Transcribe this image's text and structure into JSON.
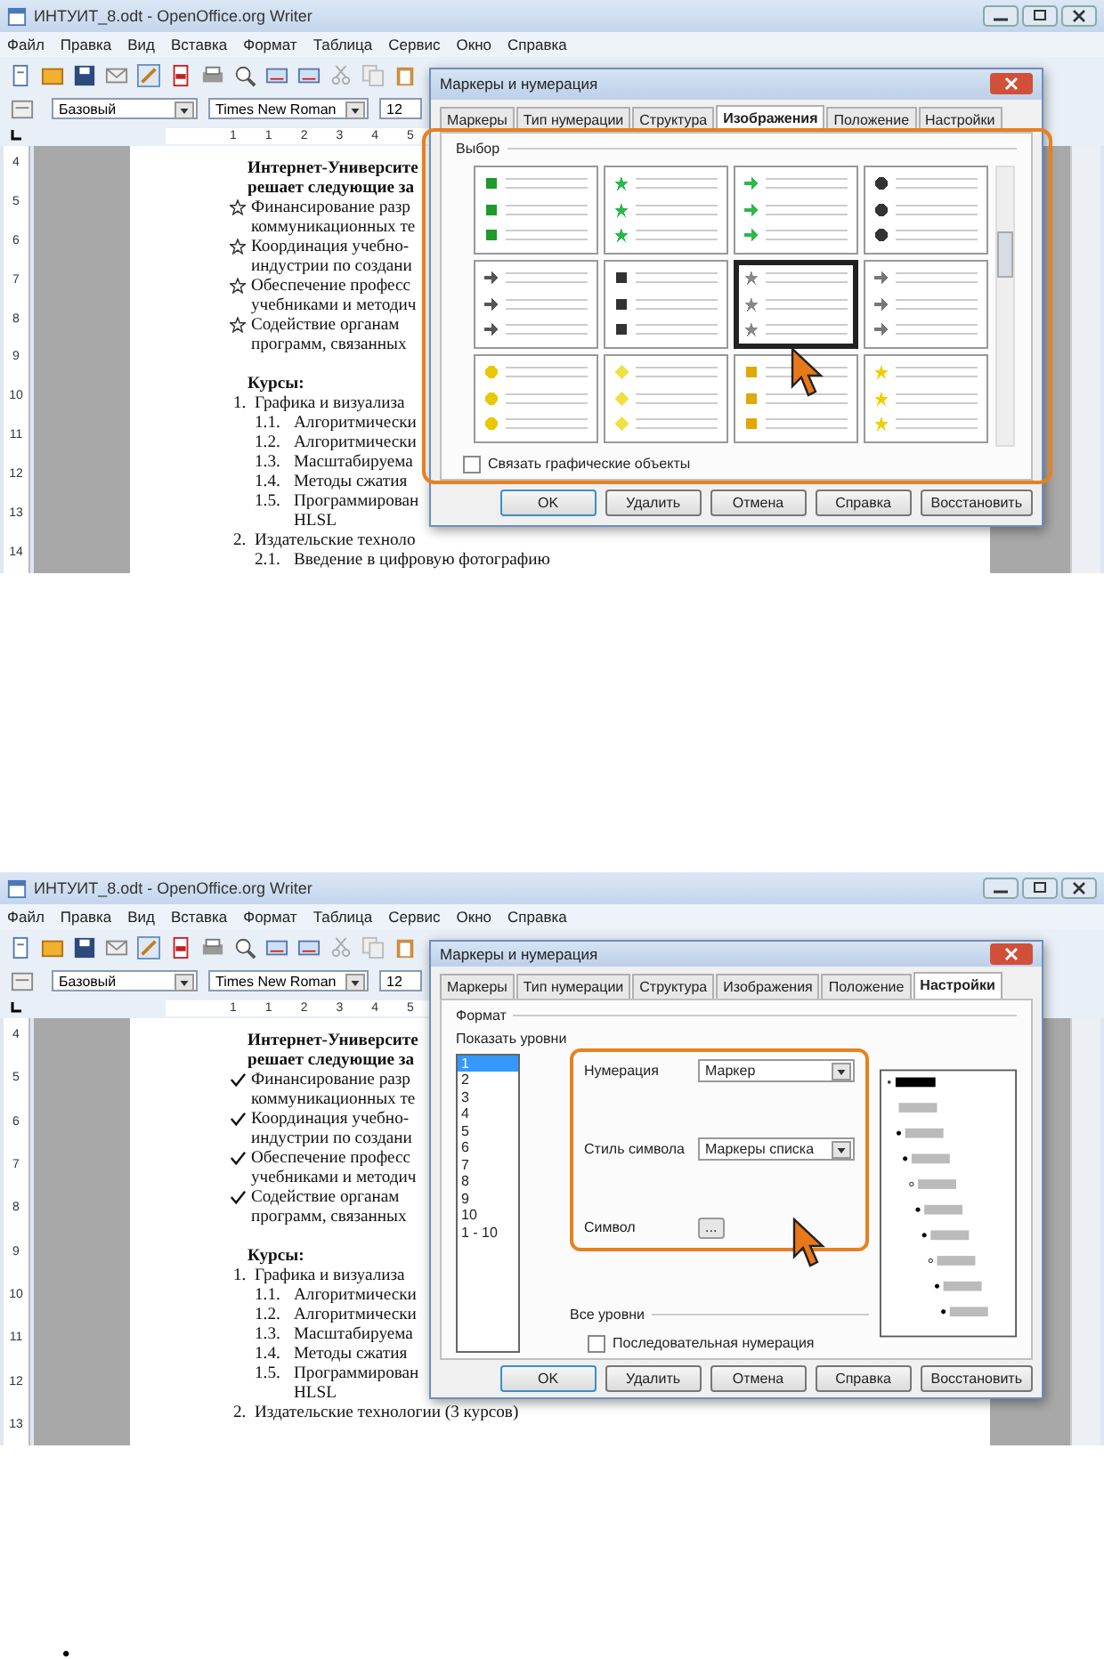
{
  "screenshots": [
    {
      "window": {
        "title": "ИНТУИТ_8.odt - OpenOffice.org Writer",
        "menu": [
          "Файл",
          "Правка",
          "Вид",
          "Вставка",
          "Формат",
          "Таблица",
          "Сервис",
          "Окно",
          "Справка"
        ],
        "style_box": "Базовый",
        "font_box": "Times New Roman",
        "size_box": "12",
        "ruler_h": [
          "1",
          "1",
          "2",
          "3",
          "4",
          "5"
        ],
        "ruler_v": [
          "4",
          "5",
          "6",
          "7",
          "8",
          "9",
          "10",
          "11",
          "12",
          "13",
          "14"
        ]
      },
      "document": {
        "heading": [
          "Интернет-Университе",
          "решает следующие за"
        ],
        "bullets": [
          {
            "kind": "star",
            "lines": [
              "Финансирование разр",
              "коммуникационных те"
            ]
          },
          {
            "kind": "star",
            "lines": [
              "Координация учебно-",
              "индустрии по создани"
            ]
          },
          {
            "kind": "star",
            "lines": [
              "Обеспечение професс",
              "учебниками и методич"
            ]
          },
          {
            "kind": "star",
            "lines": [
              "Содействие органам",
              "программ, связанных"
            ]
          }
        ],
        "section_title": "Курсы:",
        "courses": [
          {
            "num": "1.",
            "text": "Графика и визуализа",
            "children": [
              {
                "num": "1.1.",
                "text": "Алгоритмически"
              },
              {
                "num": "1.2.",
                "text": "Алгоритмически"
              },
              {
                "num": "1.3.",
                "text": "Масштабируема"
              },
              {
                "num": "1.4.",
                "text": "Методы сжатия"
              },
              {
                "num": "1.5.",
                "text": "Программирован",
                "continuation": "HLSL"
              }
            ]
          },
          {
            "num": "2.",
            "text": "Издательские техноло",
            "children": [
              {
                "num": "2.1.",
                "text": "Введение в цифровую фотографию"
              }
            ]
          }
        ]
      },
      "dialog": {
        "title": "Маркеры и нумерация",
        "tabs": [
          {
            "label": "Маркеры",
            "selected": false
          },
          {
            "label": "Тип нумерации",
            "selected": false
          },
          {
            "label": "Структура",
            "selected": false
          },
          {
            "label": "Изображения",
            "selected": true
          },
          {
            "label": "Положение",
            "selected": false
          },
          {
            "label": "Настройки",
            "selected": false
          }
        ],
        "panel": {
          "kind": "images",
          "group_label": "Выбор",
          "tiles": [
            {
              "kind": "square",
              "color": "#1e9a2a",
              "selected": false
            },
            {
              "kind": "star",
              "color": "#2ab84a",
              "selected": false
            },
            {
              "kind": "arrow",
              "color": "#2db84a",
              "selected": false
            },
            {
              "kind": "ball",
              "color": "#333333",
              "selected": false
            },
            {
              "kind": "arrow",
              "color": "#555555",
              "selected": false
            },
            {
              "kind": "square",
              "color": "#333333",
              "selected": false
            },
            {
              "kind": "star",
              "color": "#888888",
              "selected": true
            },
            {
              "kind": "arrow",
              "color": "#777777",
              "selected": false
            },
            {
              "kind": "ball",
              "color": "#e8c800",
              "selected": false
            },
            {
              "kind": "diamond",
              "color": "#f0e040",
              "selected": false
            },
            {
              "kind": "square",
              "color": "#e0a800",
              "selected": false
            },
            {
              "kind": "star",
              "color": "#f0d000",
              "selected": false
            }
          ],
          "link_checkbox": {
            "label": "Связать графические объекты",
            "checked": false
          }
        },
        "buttons": [
          "OK",
          "Удалить",
          "Отмена",
          "Справка",
          "Восстановить"
        ]
      }
    },
    {
      "window": {
        "title": "ИНТУИТ_8.odt - OpenOffice.org Writer",
        "menu": [
          "Файл",
          "Правка",
          "Вид",
          "Вставка",
          "Формат",
          "Таблица",
          "Сервис",
          "Окно",
          "Справка"
        ],
        "style_box": "Базовый",
        "font_box": "Times New Roman",
        "size_box": "12",
        "ruler_h": [
          "1",
          "1",
          "2",
          "3",
          "4",
          "5"
        ],
        "ruler_v": [
          "4",
          "5",
          "6",
          "7",
          "8",
          "9",
          "10",
          "11",
          "12",
          "13"
        ]
      },
      "document": {
        "heading": [
          "Интернет-Университе",
          "решает следующие за"
        ],
        "bullets": [
          {
            "kind": "check",
            "lines": [
              "Финансирование разр",
              "коммуникационных те"
            ]
          },
          {
            "kind": "check",
            "lines": [
              "Координация учебно-",
              "индустрии по создани"
            ]
          },
          {
            "kind": "check",
            "lines": [
              "Обеспечение професс",
              "учебниками и методич"
            ]
          },
          {
            "kind": "check",
            "lines": [
              "Содействие органам",
              "программ, связанных"
            ]
          }
        ],
        "section_title": "Курсы:",
        "courses": [
          {
            "num": "1.",
            "text": "Графика и визуализа",
            "children": [
              {
                "num": "1.1.",
                "text": "Алгоритмически"
              },
              {
                "num": "1.2.",
                "text": "Алгоритмически"
              },
              {
                "num": "1.3.",
                "text": "Масштабируема"
              },
              {
                "num": "1.4.",
                "text": "Методы сжатия"
              },
              {
                "num": "1.5.",
                "text": "Программирован",
                "continuation": "HLSL"
              }
            ]
          },
          {
            "num": "2.",
            "text": "Издательские технологии (3 курсов)"
          }
        ]
      },
      "dialog": {
        "title": "Маркеры и нумерация",
        "tabs": [
          {
            "label": "Маркеры",
            "selected": false
          },
          {
            "label": "Тип нумерации",
            "selected": false
          },
          {
            "label": "Структура",
            "selected": false
          },
          {
            "label": "Изображения",
            "selected": false
          },
          {
            "label": "Положение",
            "selected": false
          },
          {
            "label": "Настройки",
            "selected": true
          }
        ],
        "panel": {
          "kind": "settings",
          "group_label": "Формат",
          "levels_label": "Показать уровни",
          "levels": [
            {
              "label": "1",
              "selected": true
            },
            {
              "label": "2",
              "selected": false
            },
            {
              "label": "3",
              "selected": false
            },
            {
              "label": "4",
              "selected": false
            },
            {
              "label": "5",
              "selected": false
            },
            {
              "label": "6",
              "selected": false
            },
            {
              "label": "7",
              "selected": false
            },
            {
              "label": "8",
              "selected": false
            },
            {
              "label": "9",
              "selected": false
            },
            {
              "label": "10",
              "selected": false
            },
            {
              "label": "1 - 10",
              "selected": false
            }
          ],
          "numbering_label": "Нумерация",
          "numbering_value": "Маркер",
          "char_style_label": "Стиль символа",
          "char_style_value": "Маркеры списка",
          "symbol_label": "Символ",
          "symbol_button": "...",
          "all_levels_label": "Все уровни",
          "consecutive": {
            "label": "Последовательная нумерация",
            "checked": false
          }
        },
        "buttons": [
          "OK",
          "Удалить",
          "Отмена",
          "Справка",
          "Восстановить"
        ]
      }
    }
  ],
  "page_bullet": "•"
}
